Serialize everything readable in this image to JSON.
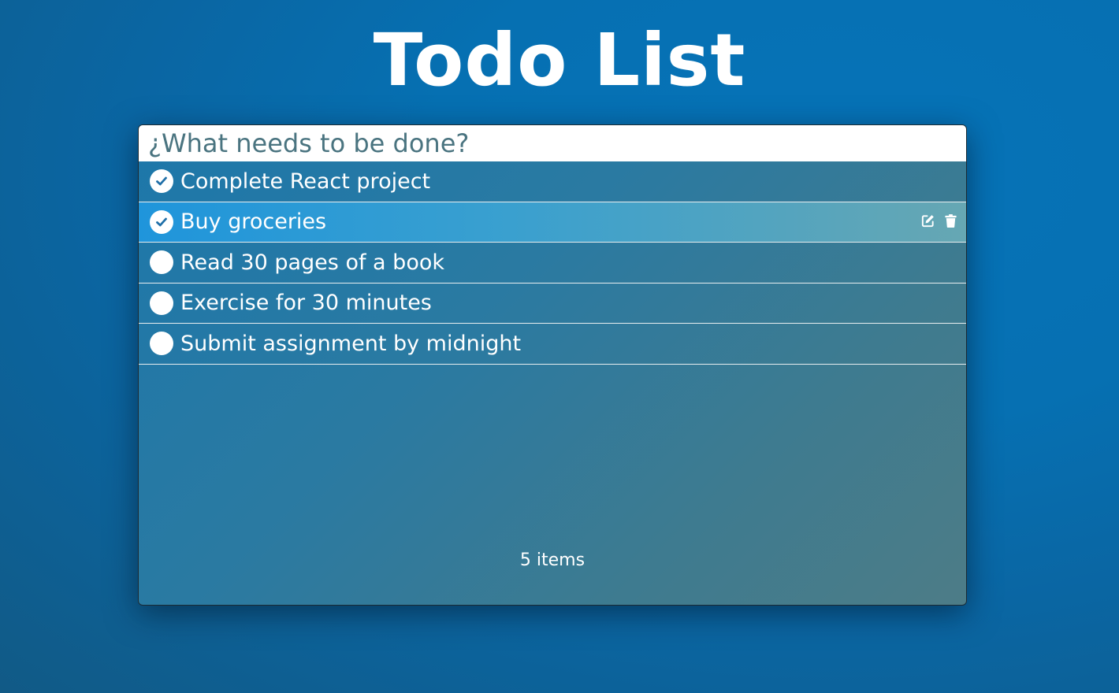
{
  "app": {
    "title": "Todo List"
  },
  "new_todo": {
    "placeholder": "¿What needs to be done?"
  },
  "todos": [
    {
      "label": "Complete React project",
      "completed": true
    },
    {
      "label": "Buy groceries",
      "completed": true,
      "hovered": true
    },
    {
      "label": "Read 30 pages of a book",
      "completed": false
    },
    {
      "label": "Exercise for 30 minutes",
      "completed": false
    },
    {
      "label": "Submit assignment by midnight",
      "completed": false
    }
  ],
  "footer": {
    "count_label": "5 items"
  },
  "icons": {
    "completed": "check-circle-icon",
    "incomplete": "empty-circle-icon",
    "edit": "edit-icon",
    "delete": "trash-icon"
  },
  "colors": {
    "check_mark": "#1f6fa8",
    "hover_row": "#1f95db",
    "placeholder_text": "#4a7480"
  }
}
